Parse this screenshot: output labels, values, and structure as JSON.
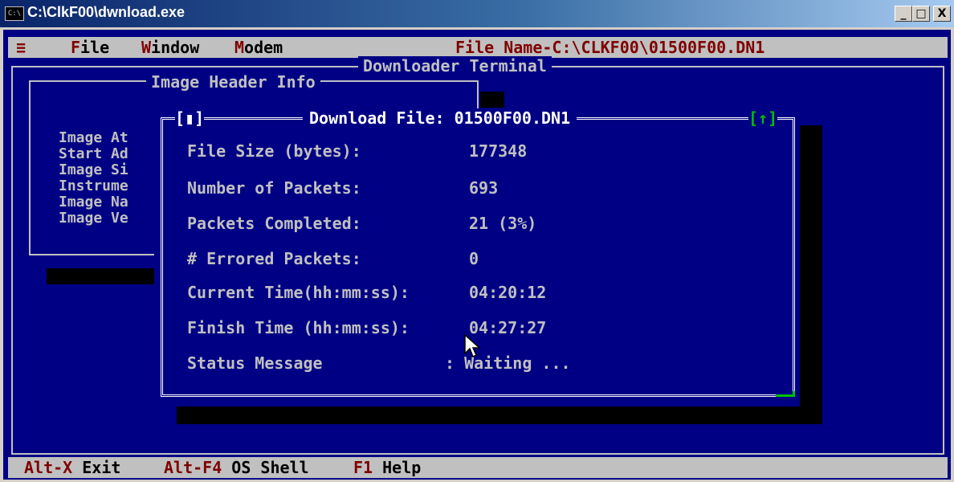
{
  "window": {
    "title": "C:\\ClkF00\\dwnload.exe",
    "icon_text": "C:\\",
    "minimize": "_",
    "maximize": "□",
    "close": "X"
  },
  "menu": {
    "system": "≡",
    "file_hot": "F",
    "file_rest": "ile",
    "window_hot": "W",
    "window_rest": "indow",
    "modem_hot": "M",
    "modem_rest": "odem",
    "file_name": "File Name-C:\\CLKF00\\01500F00.DN1"
  },
  "terminal": {
    "title": "Downloader Terminal"
  },
  "image_header": {
    "title": "Image Header Info",
    "rows": [
      "Image At",
      "Start Ad",
      "Image Si",
      "Instrume",
      "Image Na",
      "Image Ve"
    ]
  },
  "dialog": {
    "title": "Download File: 01500F00.DN1",
    "close_box": "[▮]",
    "up_box": "[↑]",
    "fields": [
      {
        "label": "File Size (bytes):",
        "value": "177348"
      },
      {
        "label": "Number of Packets:",
        "value": "693"
      },
      {
        "label": "Packets Completed:",
        "value": "21 (3%)"
      },
      {
        "label": "# Errored Packets:",
        "value": "0"
      },
      {
        "label": "Current Time(hh:mm:ss):",
        "value": "04:20:12"
      },
      {
        "label": "Finish Time (hh:mm:ss):",
        "value": "04:27:27"
      },
      {
        "label": "Status Message",
        "value": ": Waiting ..."
      }
    ]
  },
  "statusbar": {
    "exit_key": "Alt-X",
    "exit_label": "Exit",
    "shell_key": "Alt-F4",
    "shell_label": "OS Shell",
    "help_key": "F1",
    "help_label": "Help"
  },
  "colors": {
    "dos_blue": "#000084",
    "dos_gray": "#c0c0c0",
    "hotkey_red": "#800000",
    "accent_green": "#00c000"
  }
}
